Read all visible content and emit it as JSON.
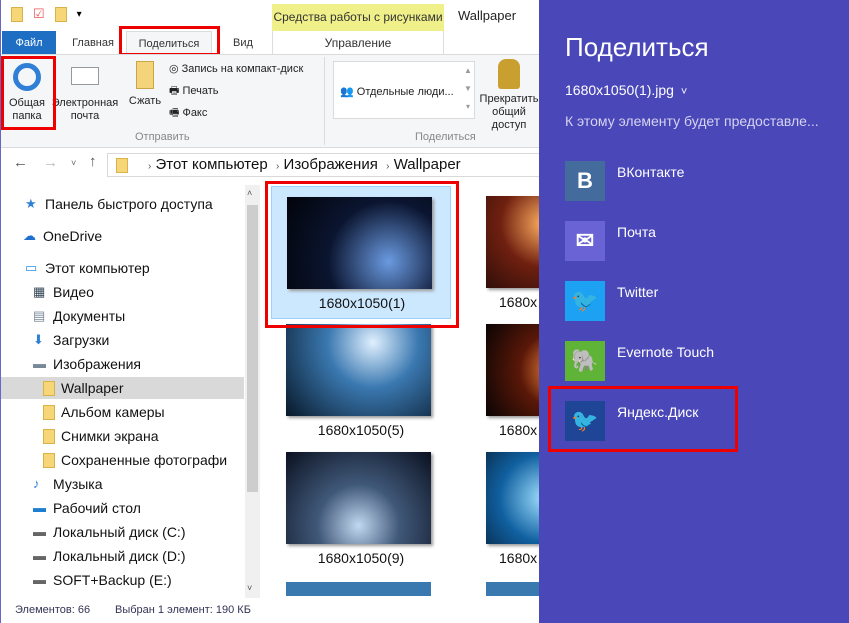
{
  "window": {
    "title": "Wallpaper",
    "context_tab": "Средства работы с рисунками",
    "context_subtab": "Управление"
  },
  "tabs": [
    "Файл",
    "Главная",
    "Поделиться",
    "Вид"
  ],
  "ribbon": {
    "share_folder": "Общая папка",
    "email": "Электронная почта",
    "zip": "Сжать",
    "burn": "Запись на компакт-диск",
    "print": "Печать",
    "fax": "Факс",
    "group_send": "Отправить",
    "people": "Отдельные люди...",
    "stop_sharing": "Прекратить общий доступ",
    "group_share": "Поделиться"
  },
  "breadcrumb": [
    "Этот компьютер",
    "Изображения",
    "Wallpaper"
  ],
  "nav": [
    {
      "label": "Панель быстрого доступа",
      "icon": "star-icon"
    },
    {
      "label": "OneDrive",
      "icon": "cloud-icon"
    },
    {
      "label": "Этот компьютер",
      "icon": "computer-icon"
    },
    {
      "label": "Видео",
      "icon": "video-icon"
    },
    {
      "label": "Документы",
      "icon": "document-icon"
    },
    {
      "label": "Загрузки",
      "icon": "download-icon"
    },
    {
      "label": "Изображения",
      "icon": "pictures-icon"
    },
    {
      "label": "Wallpaper",
      "icon": "folder-icon",
      "selected": true
    },
    {
      "label": "Альбом камеры",
      "icon": "folder-icon"
    },
    {
      "label": "Снимки экрана",
      "icon": "folder-icon"
    },
    {
      "label": "Сохраненные фотографи",
      "icon": "folder-icon"
    },
    {
      "label": "Музыка",
      "icon": "music-icon"
    },
    {
      "label": "Рабочий стол",
      "icon": "desktop-icon"
    },
    {
      "label": "Локальный диск (C:)",
      "icon": "drive-icon"
    },
    {
      "label": "Локальный диск (D:)",
      "icon": "drive-icon"
    },
    {
      "label": "SOFT+Backup (E:)",
      "icon": "drive-icon"
    }
  ],
  "files": [
    "1680x1050(1)",
    "1680x",
    "1680x1050(5)",
    "1680x",
    "1680x1050(9)",
    "1680x"
  ],
  "status": {
    "count": "Элементов: 66",
    "selected": "Выбран 1 элемент: 190 КБ"
  },
  "share": {
    "title": "Поделиться",
    "file": "1680x1050(1).jpg",
    "desc": "К этому элементу будет предоставле...",
    "apps": [
      {
        "label": "ВКонтакте",
        "color": "#436b9c"
      },
      {
        "label": "Почта",
        "color": "#6a63d6"
      },
      {
        "label": "Twitter",
        "color": "#1da1f2"
      },
      {
        "label": "Evernote Touch",
        "color": "#5fb336"
      },
      {
        "label": "Яндекс.Диск",
        "color": "#1f4696"
      }
    ]
  }
}
